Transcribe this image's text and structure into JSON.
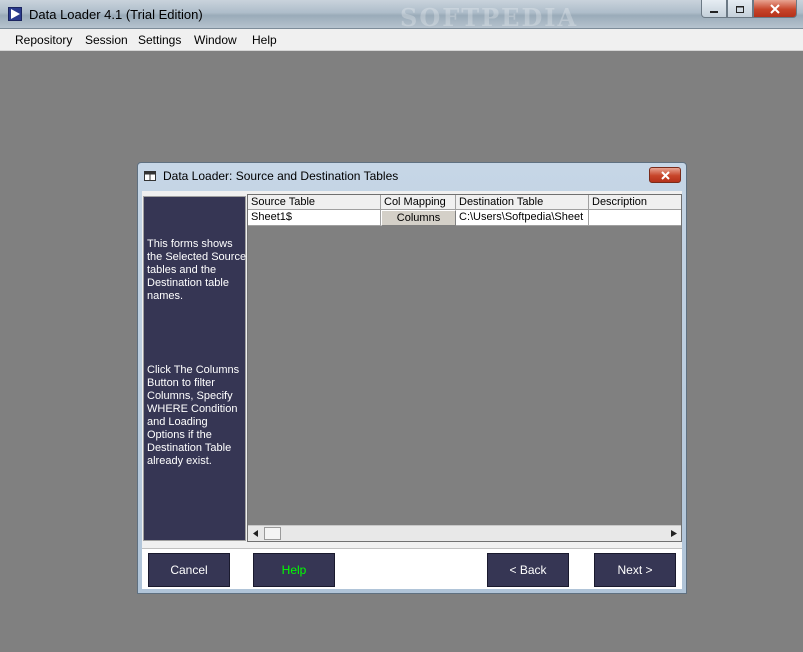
{
  "window": {
    "title": "Data Loader 4.1 (Trial Edition)",
    "watermark": "SOFTPEDIA"
  },
  "menu": [
    "Repository",
    "Session",
    "Settings",
    "Window",
    "Help"
  ],
  "dialog": {
    "title": "Data Loader: Source and Destination Tables",
    "info_text_1": "This forms shows the Selected Source tables and the Destination table names.",
    "info_text_2": "Click The Columns Button to filter Columns, Specify WHERE Condition and Loading Options if the Destination Table already exist.",
    "grid": {
      "headers": [
        "Source Table",
        "Col Mapping",
        "Destination Table",
        "Description"
      ],
      "rows": [
        {
          "source": "Sheet1$",
          "mapping": "Columns",
          "destination": "C:\\Users\\Softpedia\\Sheet",
          "description": ""
        }
      ]
    },
    "buttons": {
      "cancel": "Cancel",
      "help": "Help",
      "back": "< Back",
      "next": "Next >"
    }
  },
  "icons": {
    "close": "close-icon",
    "minimize": "minimize-icon",
    "maximize": "maximize-icon"
  },
  "colors": {
    "panel": "#363654",
    "help_text": "#00ff00",
    "mdi_background": "#808080"
  }
}
